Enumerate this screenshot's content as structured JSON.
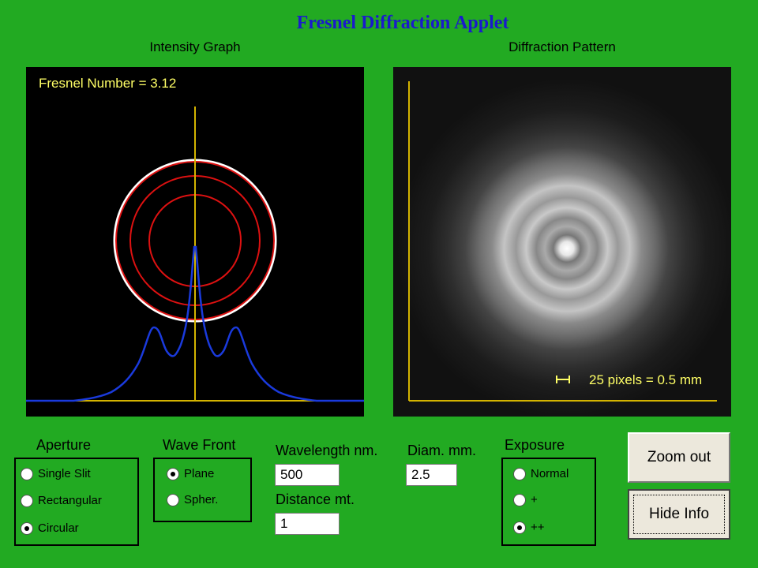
{
  "app": {
    "title": "Fresnel Diffraction Applet"
  },
  "intensity_graph": {
    "label": "Intensity Graph",
    "fresnel_number": "Fresnel Number = 3.12"
  },
  "diffraction_pattern": {
    "label": "Diffraction Pattern",
    "scale_label": "25 pixels = 0.5 mm"
  },
  "aperture": {
    "title": "Aperture",
    "options": [
      "Single Slit",
      "Rectangular",
      "Circular"
    ],
    "selected": "Circular"
  },
  "wave_front": {
    "title": "Wave Front",
    "options": [
      "Plane",
      "Spher."
    ],
    "selected": "Plane"
  },
  "wavelength": {
    "label": "Wavelength nm.",
    "value": "500"
  },
  "distance": {
    "label": "Distance mt.",
    "value": "1"
  },
  "diameter": {
    "label": "Diam. mm.",
    "value": "2.5"
  },
  "exposure": {
    "title": "Exposure",
    "options": [
      "Normal",
      "+",
      "++"
    ],
    "selected": "++"
  },
  "buttons": {
    "zoom_out": "Zoom out",
    "hide_info": "Hide Info"
  },
  "colors": {
    "background": "#22aa22",
    "title": "#1a1acc",
    "axis": "#d4b400",
    "curve": "#1a3adc",
    "rings": "#dd1111",
    "annotation": "#ffff66"
  }
}
